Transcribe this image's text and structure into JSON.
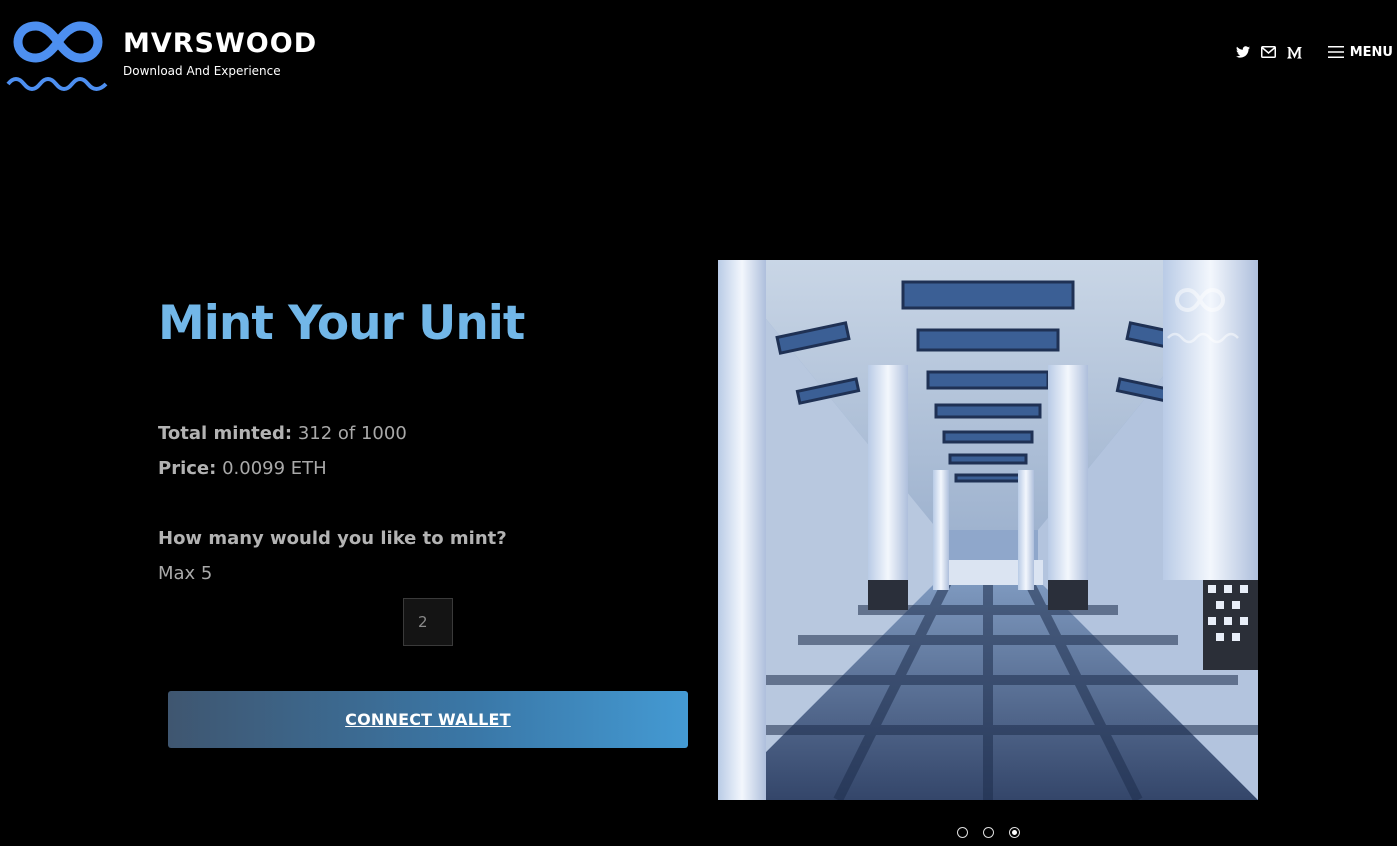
{
  "header": {
    "brand_title": "MVRSWOOD",
    "brand_subtitle": "Download And Experience",
    "logo_icon": "infinity-waves-logo",
    "brand_color": "#4d8ff0",
    "nav_icons": [
      "twitter-icon",
      "mail-icon",
      "medium-icon"
    ],
    "menu_label": "MENU"
  },
  "mint": {
    "title": "Mint Your Unit",
    "title_color": "#72b7e8",
    "total_minted_label": "Total minted:",
    "total_minted_value": "312 of 1000",
    "price_label": "Price:",
    "price_value": "0.0099 ETH",
    "question": "How many would you like to mint?",
    "max_text": "Max 5",
    "quantity_value": "2",
    "connect_label": "CONNECT WALLET"
  },
  "carousel": {
    "slide_count": 3,
    "active_index": 2
  }
}
